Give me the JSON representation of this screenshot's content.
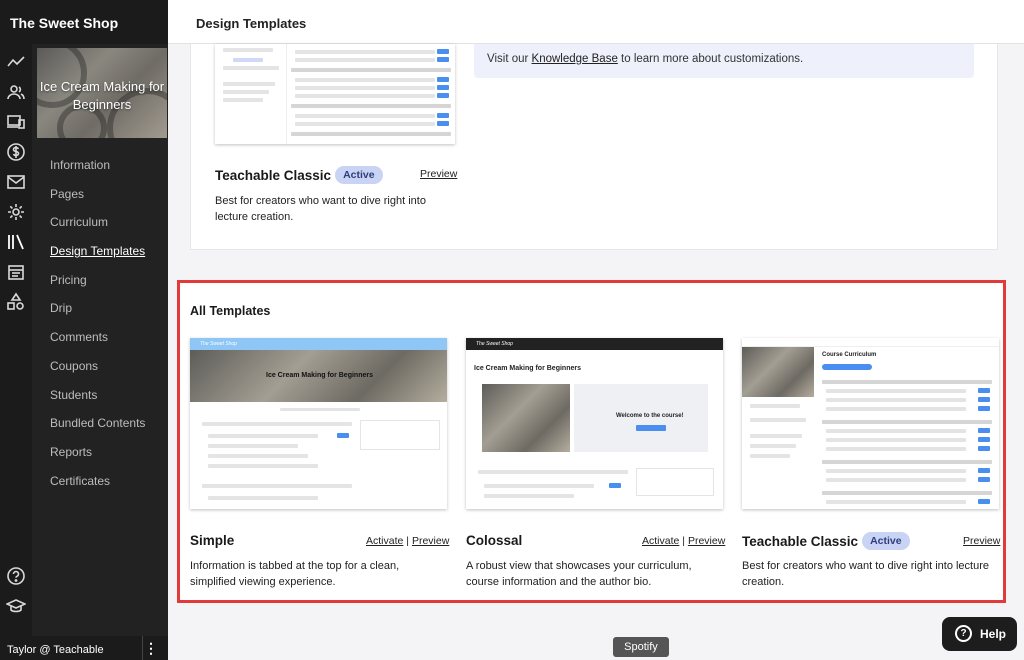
{
  "app": {
    "school_name": "The Sweet Shop"
  },
  "rail_icons": [
    "analytics-icon",
    "users-icon",
    "devices-icon",
    "dollar-icon",
    "mail-icon",
    "settings-icon",
    "library-icon",
    "calendar-icon",
    "shapes-icon",
    "help-circle-icon",
    "graduation-cap-icon"
  ],
  "course": {
    "title": "Ice Cream Making for Beginners"
  },
  "sidebar": {
    "items": [
      {
        "label": "Information"
      },
      {
        "label": "Pages"
      },
      {
        "label": "Curriculum"
      },
      {
        "label": "Design Templates",
        "active": true
      },
      {
        "label": "Pricing"
      },
      {
        "label": "Drip"
      },
      {
        "label": "Comments"
      },
      {
        "label": "Coupons"
      },
      {
        "label": "Students"
      },
      {
        "label": "Bundled Contents"
      },
      {
        "label": "Reports"
      },
      {
        "label": "Certificates"
      }
    ]
  },
  "user": {
    "name": "Taylor @ Teachable",
    "menu": "⋮"
  },
  "page": {
    "title": "Design Templates"
  },
  "knowledge_banner": {
    "prefix": "Visit our ",
    "link": "Knowledge Base",
    "suffix": " to learn more about customizations."
  },
  "current_template": {
    "name": "Teachable Classic",
    "badge": "Active",
    "preview": "Preview",
    "description": "Best for creators who want to dive right into lecture creation."
  },
  "all_templates": {
    "heading": "All Templates",
    "items": [
      {
        "name": "Simple",
        "activate": "Activate",
        "separator": "|",
        "preview": "Preview",
        "description": "Information is tabbed at the top for a clean, simplified viewing experience.",
        "thumb_title": "Ice Cream Making for Beginners"
      },
      {
        "name": "Colossal",
        "activate": "Activate",
        "separator": "|",
        "preview": "Preview",
        "description": "A robust view that showcases your curriculum, course information and the author bio.",
        "thumb_title": "Ice Cream Making for Beginners",
        "thumb_welcome": "Welcome to the course!"
      },
      {
        "name": "Teachable Classic",
        "badge": "Active",
        "preview": "Preview",
        "description": "Best for creators who want to dive right into lecture creation.",
        "thumb_title": "Course Curriculum"
      }
    ]
  },
  "tooltip": {
    "text": "Spotify"
  },
  "help": {
    "label": "Help",
    "icon": "?"
  },
  "colors": {
    "sidebar_bg": "#222222",
    "highlight_border": "#e23a3a",
    "badge_bg": "#c9d4f5",
    "accent_blue": "#4a8ff0"
  }
}
